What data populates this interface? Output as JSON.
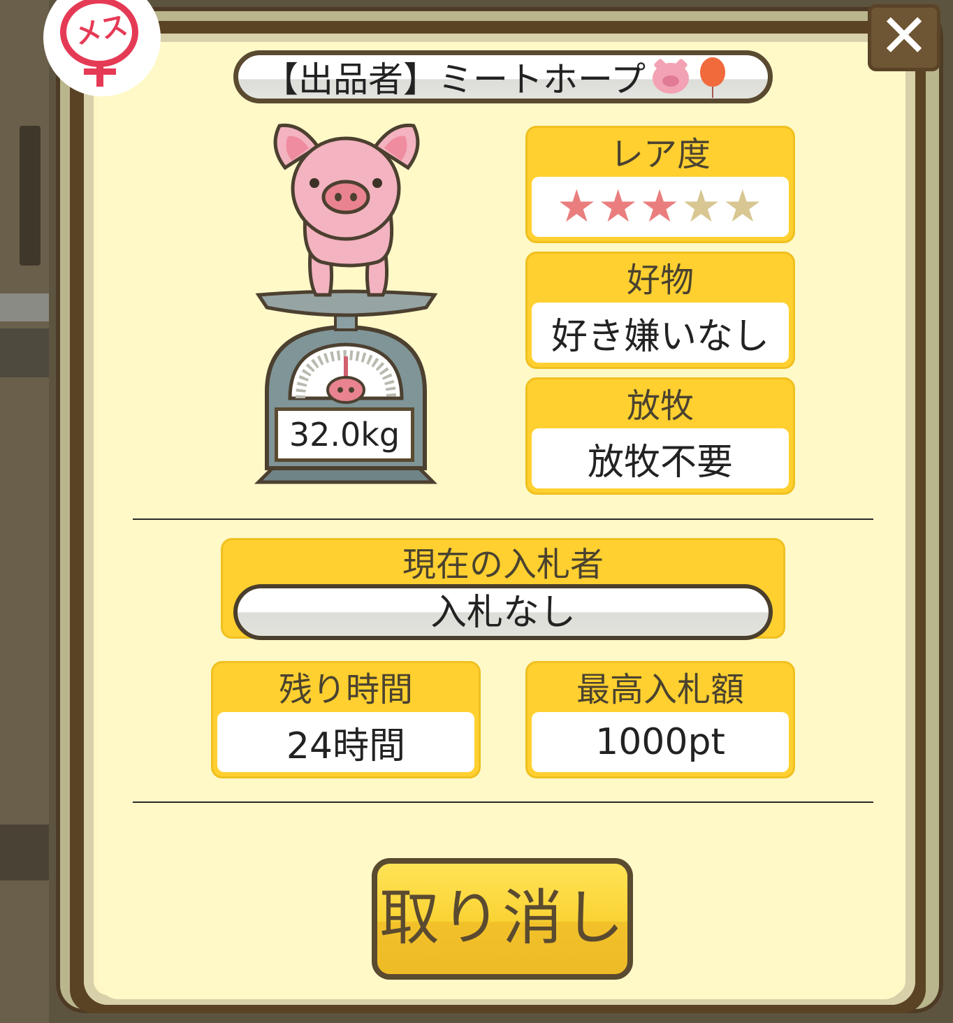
{
  "dialog": {
    "gender_badge": "メス",
    "close_label": "✕",
    "seller": {
      "text": "【出品者】ミートホープ",
      "emoji": [
        "pig-face-emoji",
        "balloon-emoji"
      ]
    },
    "weight": "32.0kg"
  },
  "cards": {
    "rarity": {
      "label": "レア度",
      "stars_on": "★★★",
      "stars_off": "★★",
      "rating": 3,
      "max": 5
    },
    "favorite_food": {
      "label": "好物",
      "value": "好き嫌いなし"
    },
    "grazing": {
      "label": "放牧",
      "value": "放牧不要"
    },
    "current_bidder": {
      "label": "現在の入札者",
      "value": "入札なし"
    },
    "time_left": {
      "label": "残り時間",
      "value": "24時間"
    },
    "highest_bid": {
      "label": "最高入札額",
      "value": "1000pt"
    }
  },
  "actions": {
    "cancel_label": "取り消し"
  },
  "colors": {
    "panel": "#fff9c8",
    "card_header": "#ffd02f",
    "frame_brown": "#5a4224",
    "star_on": "#ea7e7e",
    "star_off": "#d8c792",
    "female": "#e53a55"
  }
}
